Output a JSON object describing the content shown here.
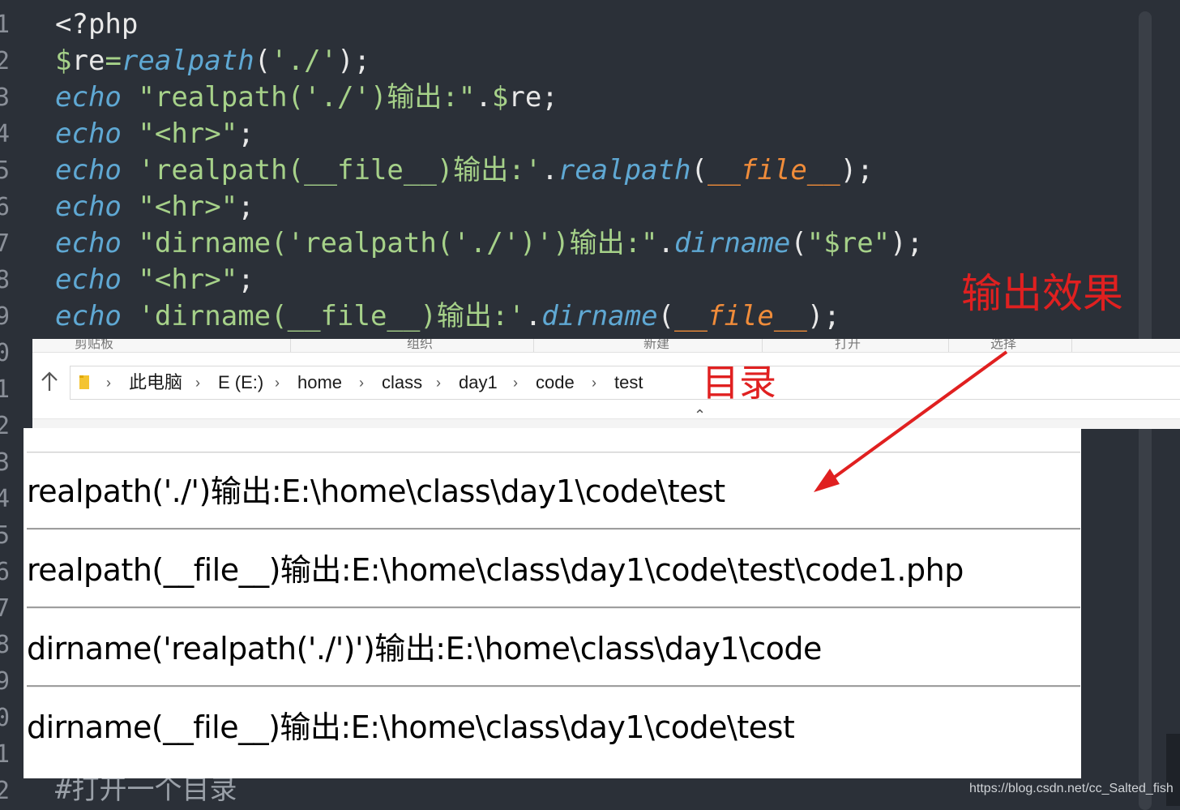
{
  "editor": {
    "line_numbers": [
      "1",
      "2",
      "3",
      "4",
      "5",
      "6",
      "7",
      "8",
      "9",
      "0",
      "1",
      "2",
      "3",
      "4",
      "5",
      "6",
      "7",
      "8",
      "9",
      "0",
      "1",
      "2"
    ],
    "lines": [
      [
        {
          "t": "<?php",
          "c": "pun"
        }
      ],
      [
        {
          "t": "$",
          "c": "dollar"
        },
        {
          "t": "re",
          "c": "var"
        },
        {
          "t": "=",
          "c": "dollar"
        },
        {
          "t": "realpath",
          "c": "fn"
        },
        {
          "t": "(",
          "c": "pun"
        },
        {
          "t": "'./'",
          "c": "str"
        },
        {
          "t": ");",
          "c": "pun"
        }
      ],
      [
        {
          "t": "echo",
          "c": "kw"
        },
        {
          "t": " ",
          "c": "pun"
        },
        {
          "t": "\"realpath('./')输出:\"",
          "c": "str"
        },
        {
          "t": ".",
          "c": "pun"
        },
        {
          "t": "$",
          "c": "dollar"
        },
        {
          "t": "re;",
          "c": "var"
        }
      ],
      [
        {
          "t": "echo",
          "c": "kw"
        },
        {
          "t": " ",
          "c": "pun"
        },
        {
          "t": "\"<hr>\"",
          "c": "str"
        },
        {
          "t": ";",
          "c": "pun"
        }
      ],
      [
        {
          "t": "echo",
          "c": "kw"
        },
        {
          "t": " ",
          "c": "pun"
        },
        {
          "t": "'realpath(__file__)输出:'",
          "c": "str"
        },
        {
          "t": ".",
          "c": "pun"
        },
        {
          "t": "realpath",
          "c": "fn"
        },
        {
          "t": "(",
          "c": "pun"
        },
        {
          "t": "__file__",
          "c": "mag"
        },
        {
          "t": ");",
          "c": "pun"
        }
      ],
      [
        {
          "t": "echo",
          "c": "kw"
        },
        {
          "t": " ",
          "c": "pun"
        },
        {
          "t": "\"<hr>\"",
          "c": "str"
        },
        {
          "t": ";",
          "c": "pun"
        }
      ],
      [
        {
          "t": "echo",
          "c": "kw"
        },
        {
          "t": " ",
          "c": "pun"
        },
        {
          "t": "\"dirname('realpath('./')')输出:\"",
          "c": "str"
        },
        {
          "t": ".",
          "c": "pun"
        },
        {
          "t": "dirname",
          "c": "fn"
        },
        {
          "t": "(",
          "c": "pun"
        },
        {
          "t": "\"$re\"",
          "c": "str"
        },
        {
          "t": ");",
          "c": "pun"
        }
      ],
      [
        {
          "t": "echo",
          "c": "kw"
        },
        {
          "t": " ",
          "c": "pun"
        },
        {
          "t": "\"<hr>\"",
          "c": "str"
        },
        {
          "t": ";",
          "c": "pun"
        }
      ],
      [
        {
          "t": "echo",
          "c": "kw"
        },
        {
          "t": " ",
          "c": "pun"
        },
        {
          "t": "'dirname(__file__)输出:'",
          "c": "str"
        },
        {
          "t": ".",
          "c": "pun"
        },
        {
          "t": "dirname",
          "c": "fn"
        },
        {
          "t": "(",
          "c": "pun"
        },
        {
          "t": "__file__",
          "c": "mag"
        },
        {
          "t": ");",
          "c": "pun"
        }
      ]
    ],
    "comment_line": "#打开一个目录"
  },
  "annotations": {
    "output_label": "输出效果",
    "directory_label": "目录"
  },
  "explorer": {
    "ribbon_labels": [
      "剪贴板",
      "组织",
      "新建",
      "打开",
      "选择"
    ],
    "breadcrumb": [
      "此电脑",
      "E (E:)",
      "home",
      "class",
      "day1",
      "code",
      "test"
    ]
  },
  "output": {
    "lines": [
      "realpath('./')输出:E:\\home\\class\\day1\\code\\test",
      "realpath(__file__)输出:E:\\home\\class\\day1\\code\\test\\code1.php",
      "dirname('realpath('./')')输出:E:\\home\\class\\day1\\code",
      "dirname(__file__)输出:E:\\home\\class\\day1\\code\\test"
    ]
  },
  "watermark": "https://blog.csdn.net/cc_Salted_fish",
  "colors": {
    "editor_bg": "#2b3038",
    "keyword": "#5fa8d3",
    "string": "#a6d189",
    "magic_constant": "#f08c3a",
    "annotation_red": "#e02020"
  }
}
